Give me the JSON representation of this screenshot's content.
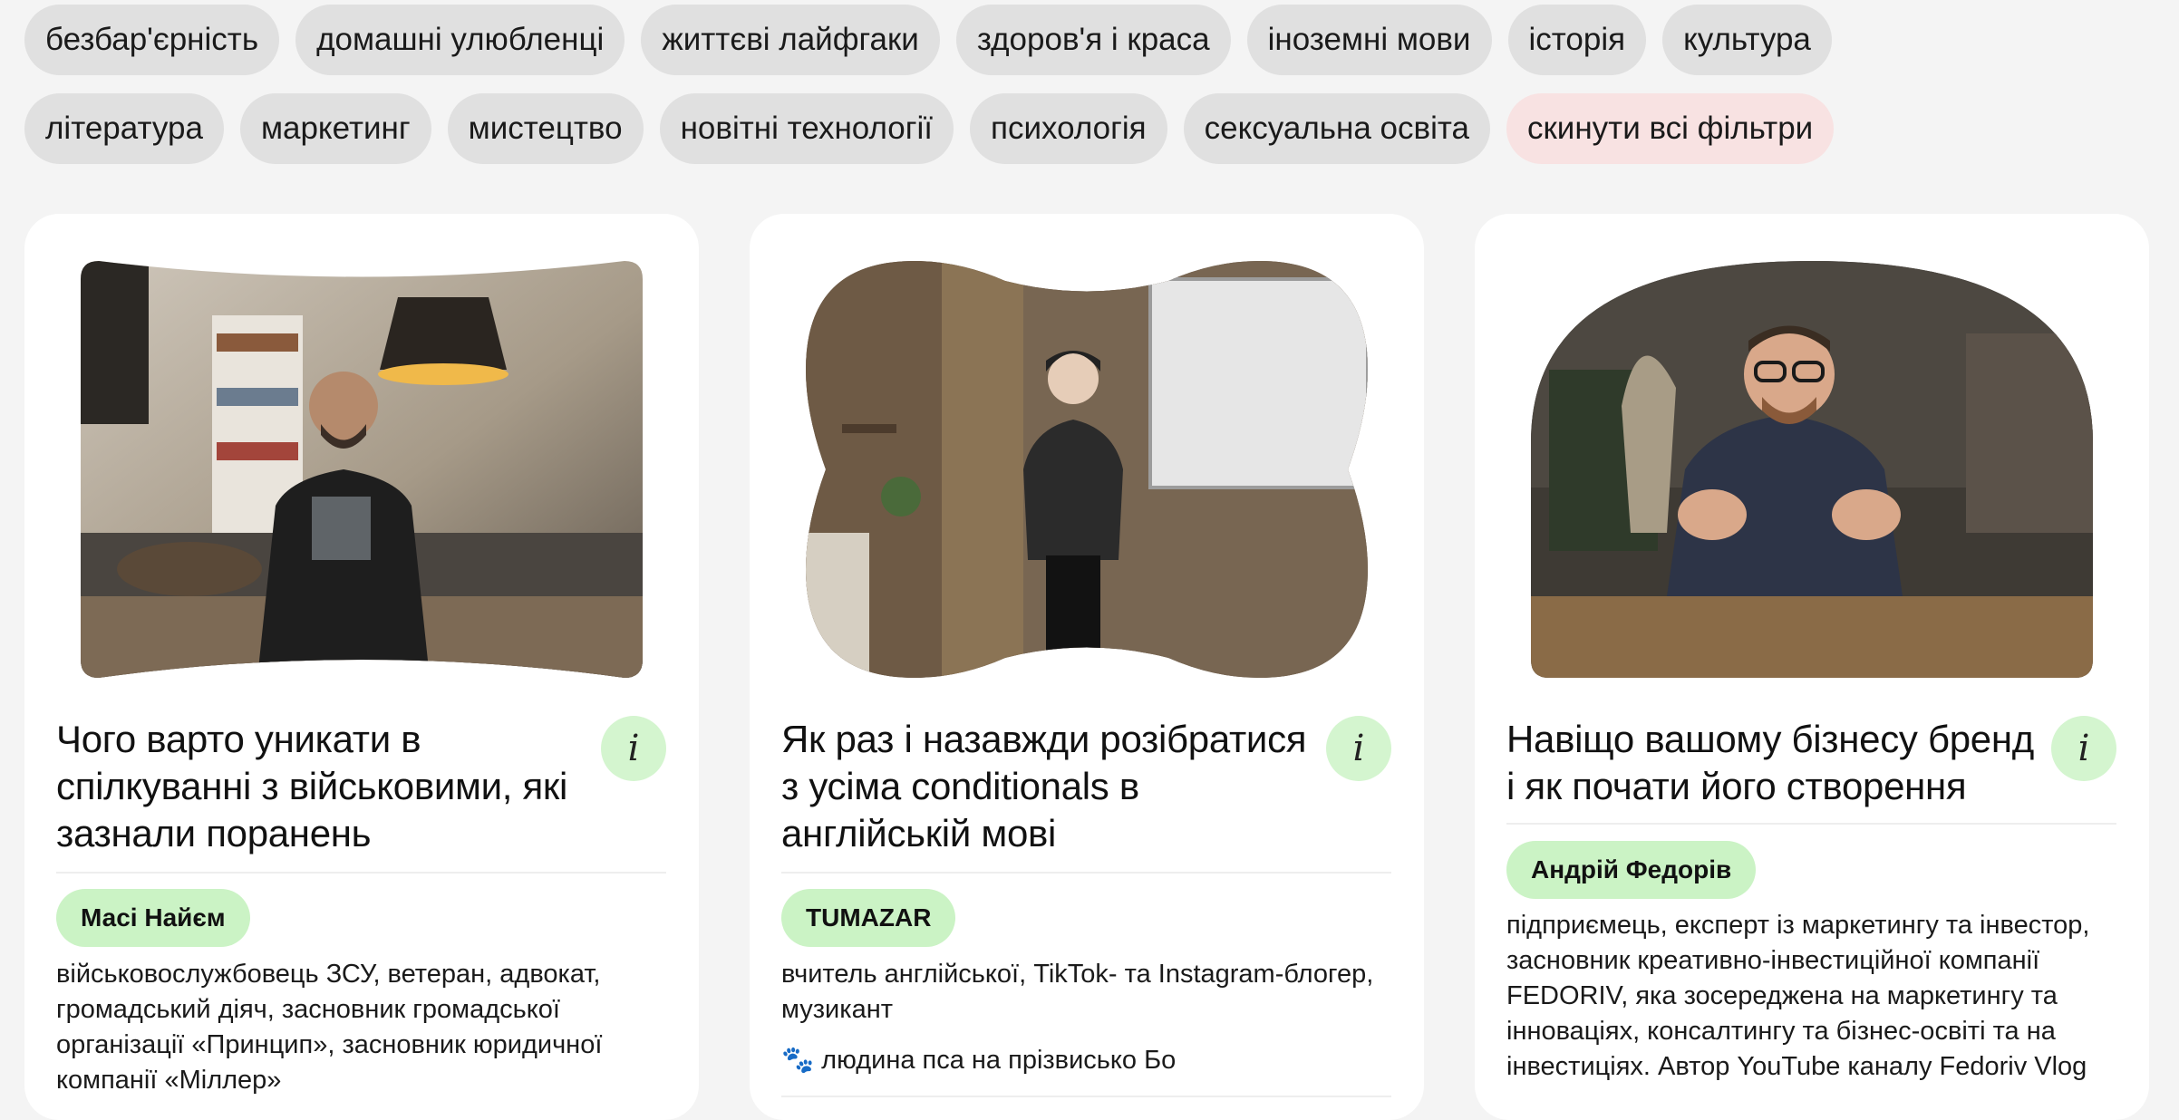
{
  "filters": {
    "row1": [
      "безбар'єрність",
      "домашні улюбленці",
      "життєві лайфгаки",
      "здоров'я і краса",
      "іноземні мови",
      "історія",
      "культура"
    ],
    "row2": [
      "література",
      "маркетинг",
      "мистецтво",
      "новітні технології",
      "психологія",
      "сексуальна освіта"
    ],
    "reset_label": "скинути всі фільтри"
  },
  "colors": {
    "page_bg": "#f4f4f4",
    "chip_bg": "#e0e0e0",
    "reset_bg": "#f8e2e2",
    "author_badge_bg": "#cbf3c5",
    "info_button_bg": "#d4f5cf"
  },
  "info_icon": "i",
  "cards": [
    {
      "title": "Чого варто уникати в спілкуванні з військовими, які зазнали поранень",
      "author": "Масі Найєм",
      "bio": "військовослужбовець ЗСУ, ветеран, адвокат, громадський діяч, засновник громадської організації «Принцип», засновник юридичної компанії «Міллер»",
      "note": "",
      "photo_shape": "wave"
    },
    {
      "title": "Як раз і назавжди розібратися з усіма conditionals в англійській мові",
      "author": "TUMAZAR",
      "bio": "вчитель англійської, TikTok- та Instagram-блогер, музикант",
      "note": "🐾 людина пса на прізвисько Бо",
      "photo_shape": "blob"
    },
    {
      "title": "Навіщо вашому бізнесу бренд і як почати його створення",
      "author": "Андрій Федорів",
      "bio": "підприємець, експерт із маркетингу та інвестор, засновник креативно-інвестиційної компанії FEDORIV, яка зосереджена на маркетингу та інноваціях, консалтингу та бізнес-освіті та на інвестиціях. Автор YouTube каналу Fedoriv Vlog",
      "note": "",
      "photo_shape": "arch"
    }
  ]
}
